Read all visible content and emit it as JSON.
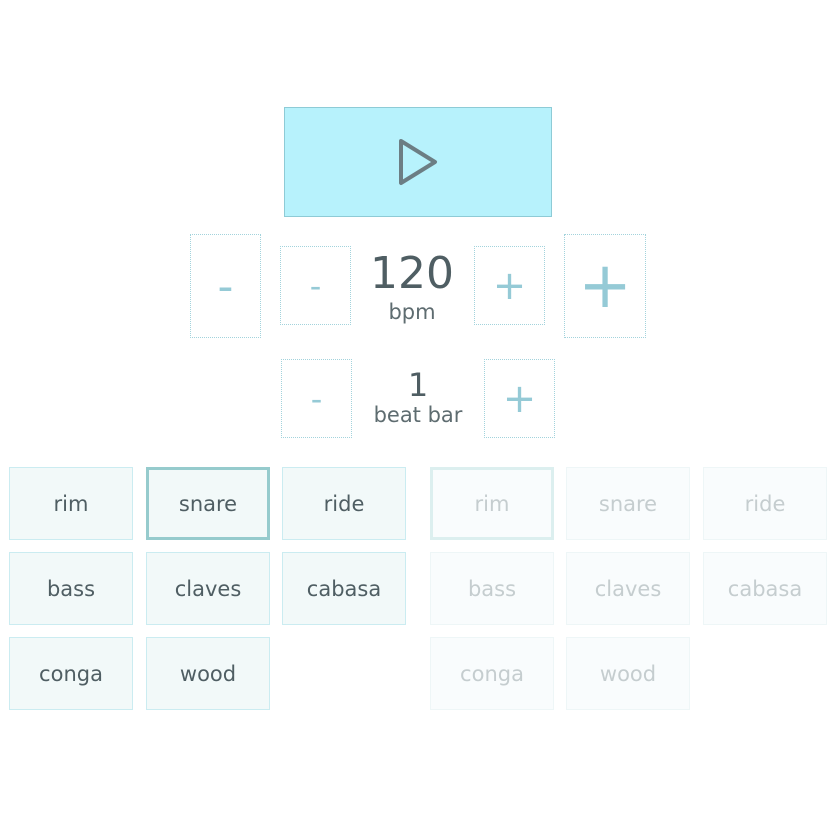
{
  "transport": {
    "play_icon": "play-icon",
    "play_color": "#b7f2fc"
  },
  "tempo": {
    "value": "120",
    "unit": "bpm",
    "dec_big_label": "-",
    "dec_small_label": "-",
    "inc_small_label": "+",
    "inc_big_label": "+"
  },
  "beats": {
    "value": "1",
    "unit": "beat bar",
    "dec_label": "-",
    "inc_label": "+"
  },
  "pads_left": [
    {
      "label": "rim",
      "selected": false
    },
    {
      "label": "snare",
      "selected": true
    },
    {
      "label": "ride",
      "selected": false
    },
    {
      "label": "bass",
      "selected": false
    },
    {
      "label": "claves",
      "selected": false
    },
    {
      "label": "cabasa",
      "selected": false
    },
    {
      "label": "conga",
      "selected": false
    },
    {
      "label": "wood",
      "selected": false
    }
  ],
  "pads_right": [
    {
      "label": "rim",
      "selected": true
    },
    {
      "label": "snare",
      "selected": false
    },
    {
      "label": "ride",
      "selected": false
    },
    {
      "label": "bass",
      "selected": false
    },
    {
      "label": "claves",
      "selected": false
    },
    {
      "label": "cabasa",
      "selected": false
    },
    {
      "label": "conga",
      "selected": false
    },
    {
      "label": "wood",
      "selected": false
    }
  ]
}
